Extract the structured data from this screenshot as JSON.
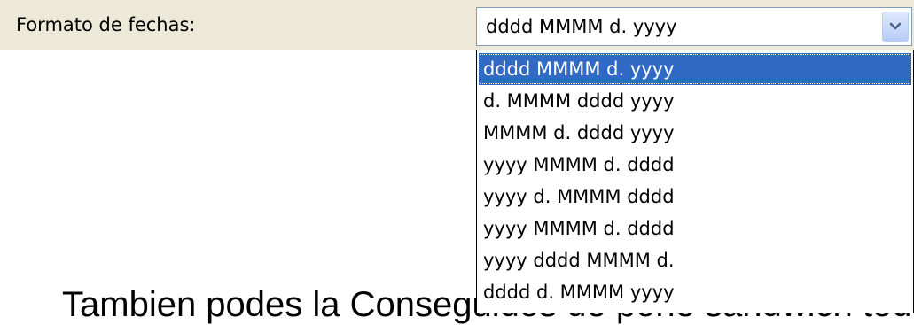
{
  "date_format": {
    "label": "Formato de fechas:",
    "current_value": "dddd MMMM d. yyyy",
    "arrow_icon": "chevron-down-icon",
    "options": [
      "dddd MMMM d. yyyy",
      "d. MMMM dddd yyyy",
      "MMMM d. dddd yyyy",
      "yyyy MMMM d. dddd",
      "yyyy d. MMMM dddd",
      "yyyy MMMM d. dddd",
      "yyyy dddd MMMM d.",
      "dddd d. MMMM yyyy"
    ],
    "selected_index": 0
  },
  "caption": {
    "text": "Tambien podes la Conseguidos de pone sandwich todos"
  },
  "colors": {
    "panel_bg": "#ece9d8",
    "selection_bg": "#316ac5",
    "selection_text": "#ffffff",
    "combo_border": "#7f9db9"
  }
}
